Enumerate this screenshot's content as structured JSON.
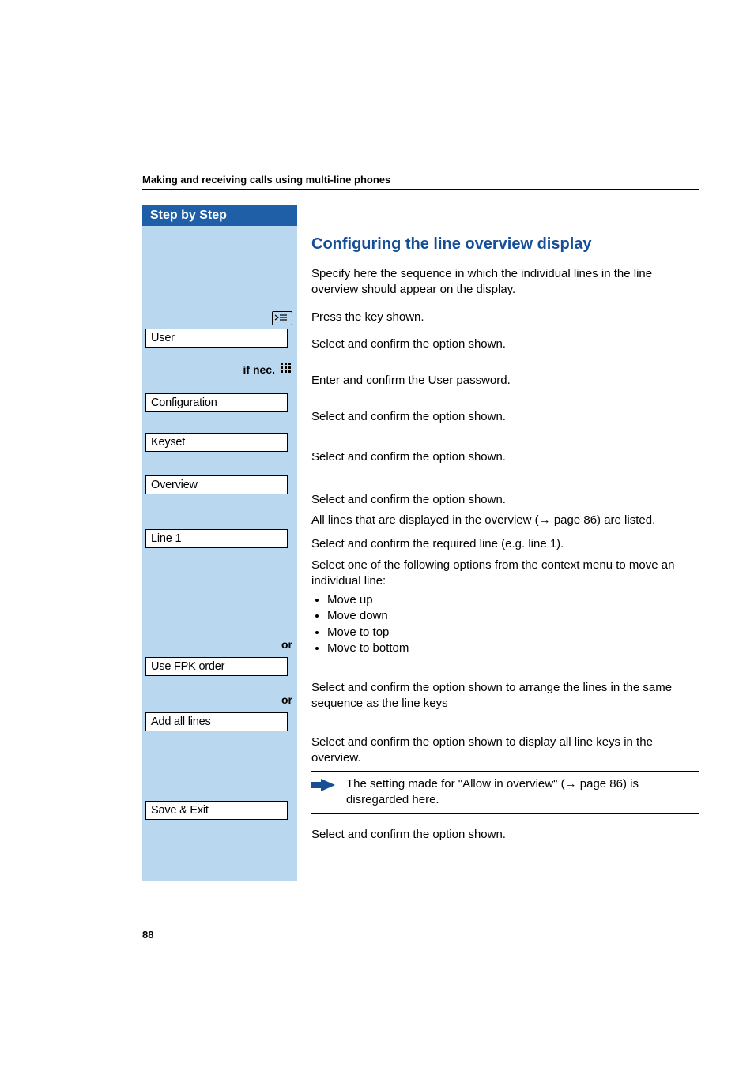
{
  "running_head": "Making and receiving calls using multi-line phones",
  "sidebar_header": "Step by Step",
  "section_title": "Configuring the line overview display",
  "intro": "Specify here the sequence in which the individual lines in the line overview should appear on the display.",
  "press_key": "Press the key shown.",
  "menu": {
    "user": "User",
    "configuration": "Configuration",
    "keyset": "Keyset",
    "overview": "Overview",
    "line1": "Line 1",
    "use_fpk": "Use FPK order",
    "add_all": "Add all lines",
    "save_exit": "Save & Exit"
  },
  "if_nec": "if nec.",
  "or1": "or",
  "or2": "or",
  "select_confirm": "Select and confirm the option shown.",
  "enter_password": "Enter and confirm the User password.",
  "all_lines_listed_pre": "All lines that are displayed in the overview (",
  "all_lines_listed_post": " page 86) are listed.",
  "select_line1": "Select and confirm the required line (e.g. line 1).",
  "context_intro": "Select one of the following options from the context menu to move an individual line:",
  "move_opts": [
    "Move up",
    "Move down",
    "Move to top",
    "Move to bottom"
  ],
  "use_fpk_desc": "Select and confirm the option shown to arrange the lines in the same sequence as the line keys",
  "add_all_desc": "Select and confirm the option shown to display all line keys in the overview.",
  "note_pre": "The setting made for \"Allow in overview\" (",
  "note_post": " page 86) is disregarded here.",
  "arrow": "→",
  "page_num": "88"
}
